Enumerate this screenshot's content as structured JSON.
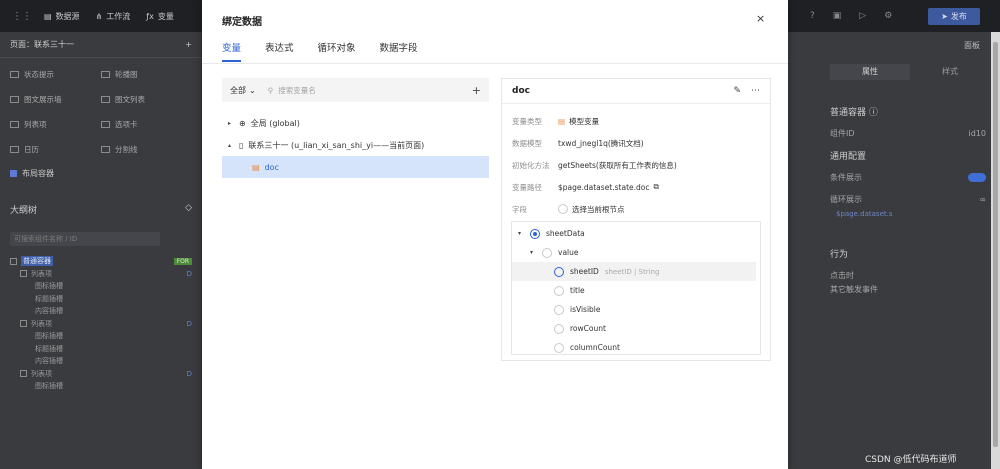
{
  "topbar": {
    "items": [
      "数据源",
      "工作流",
      "变量"
    ],
    "publish": "发布"
  },
  "leftpane": {
    "page_label": "页面：联系三十一",
    "components": [
      "状态提示",
      "轮播图",
      "图文展示墙",
      "图文列表",
      "列表项",
      "选项卡",
      "日历",
      "分割线"
    ],
    "layout": "布局容器",
    "tree_title": "大纲树",
    "tree_search": "可搜索组件名称 / ID",
    "tree": [
      {
        "label": "普通容器",
        "badge": "FOR",
        "level": 0,
        "selected": true
      },
      {
        "label": "列表项",
        "d": "D",
        "level": 1
      },
      {
        "label": "图标插槽",
        "level": 2
      },
      {
        "label": "标题插槽",
        "level": 2
      },
      {
        "label": "内容插槽",
        "level": 2
      },
      {
        "label": "列表项",
        "d": "D",
        "level": 1
      },
      {
        "label": "图标插槽",
        "level": 2
      },
      {
        "label": "标题插槽",
        "level": 2
      },
      {
        "label": "内容插槽",
        "level": 2
      },
      {
        "label": "列表项",
        "d": "D",
        "level": 1
      },
      {
        "label": "图标插槽",
        "level": 2
      }
    ]
  },
  "rightpane": {
    "top": "面板",
    "tabs": [
      "属性",
      "样式"
    ],
    "container": "普通容器 ⓘ",
    "id_label": "组件ID",
    "id_value": "id10",
    "general": "通用配置",
    "conditional": "条件展示",
    "loop": "循环展示",
    "loop_expr": "$page.dataset.s",
    "behavior": "行为",
    "on_click": "点击时",
    "other_events": "其它触发事件"
  },
  "modal": {
    "title": "绑定数据",
    "close_icon": "×",
    "tabs": [
      "变量",
      "表达式",
      "循环对象",
      "数据字段"
    ],
    "active_tab": 0,
    "filter": {
      "select": "全部",
      "placeholder": "搜索变量名",
      "add": "+"
    },
    "tree": [
      {
        "label": "全局 (global)",
        "icon": "globe-icon",
        "caret": "▸"
      },
      {
        "label": "联系三十一 (u_lian_xi_san_shi_yi——当前页面)",
        "icon": "page-icon",
        "caret": "▴"
      },
      {
        "label": "doc",
        "icon": "model-icon",
        "selected": true
      }
    ],
    "detail": {
      "title": "doc",
      "rows": [
        {
          "key": "变量类型",
          "value": "模型变量",
          "icon": "model-icon"
        },
        {
          "key": "数据模型",
          "value": "txwd_jnegl1q(腾讯文档)"
        },
        {
          "key": "初始化方法",
          "value": "getSheets(获取所有工作表的信息)"
        },
        {
          "key": "变量路径",
          "value": "$page.dataset.state.doc",
          "icon": "copy-icon"
        },
        {
          "key": "字段",
          "value": "选择当前根节点",
          "radio": true
        }
      ],
      "fields": [
        {
          "label": "sheetData",
          "caret": "▾",
          "radio": "on",
          "indent": 0
        },
        {
          "label": "value",
          "caret": "▾",
          "radio": "off",
          "indent": 1
        },
        {
          "label": "sheetID",
          "meta": "sheetID | String",
          "radio": "blue",
          "indent": 2,
          "highlight": true
        },
        {
          "label": "title",
          "radio": "off",
          "indent": 2
        },
        {
          "label": "isVisible",
          "radio": "off",
          "indent": 2
        },
        {
          "label": "rowCount",
          "radio": "off",
          "indent": 2
        },
        {
          "label": "columnCount",
          "radio": "off",
          "indent": 2
        }
      ]
    }
  },
  "watermark": "CSDN @低代码布道师"
}
